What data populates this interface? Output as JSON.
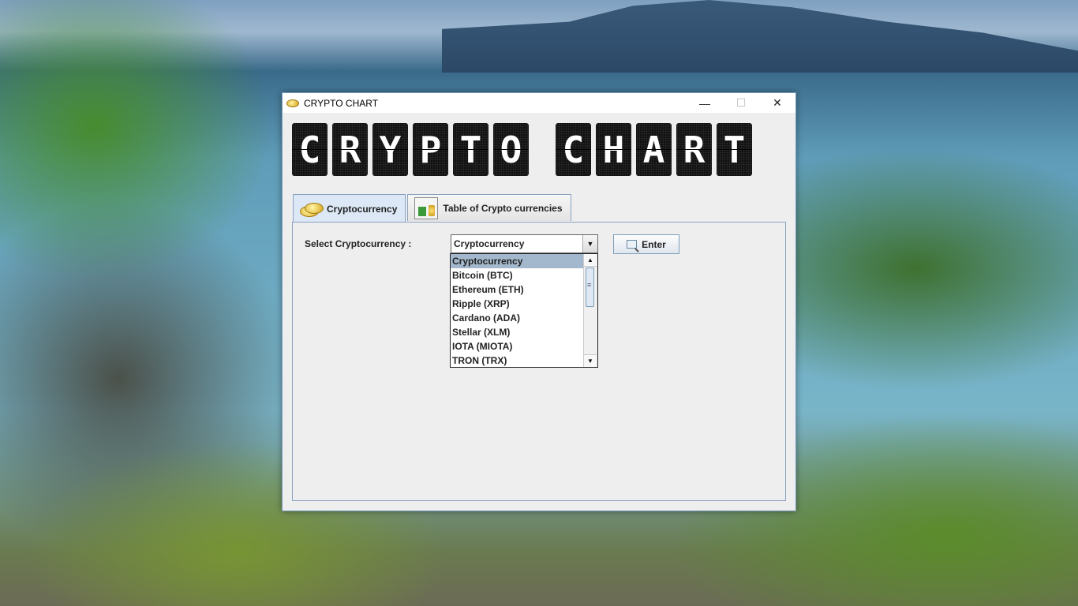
{
  "window": {
    "title": "CRYPTO CHART",
    "banner_letters": [
      "C",
      "R",
      "Y",
      "P",
      "T",
      "O",
      " ",
      "C",
      "H",
      "A",
      "R",
      "T"
    ],
    "controls": {
      "minimize": "—",
      "maximize": "☐",
      "close": "✕"
    }
  },
  "tabs": [
    {
      "label": "Cryptocurrency",
      "icon": "coins-icon",
      "active": true
    },
    {
      "label": "Table of Crypto currencies",
      "icon": "chart-coins-icon",
      "active": false
    }
  ],
  "form": {
    "select_label": "Select Cryptocurrency :",
    "combo_value": "Cryptocurrency",
    "enter_label": "Enter"
  },
  "dropdown": {
    "options": [
      "Cryptocurrency",
      "Bitcoin (BTC)",
      "Ethereum (ETH)",
      "Ripple (XRP)",
      "Cardano (ADA)",
      "Stellar (XLM)",
      "IOTA (MIOTA)",
      "TRON (TRX)"
    ],
    "selected_index": 0
  }
}
